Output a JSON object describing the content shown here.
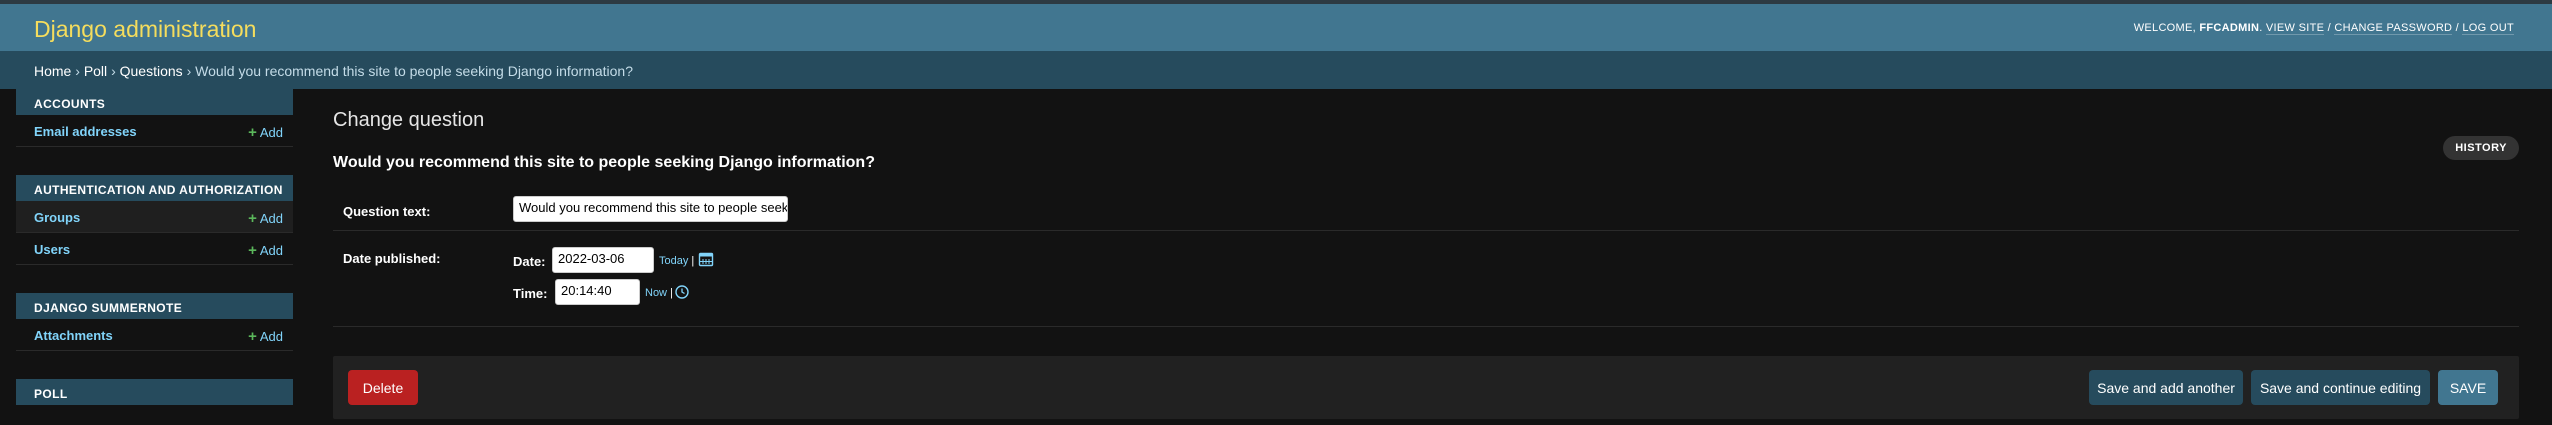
{
  "header": {
    "brand": "Django administration",
    "welcome": "WELCOME,",
    "username": "FFCADMIN",
    "view_site": "VIEW SITE",
    "change_password": "CHANGE PASSWORD",
    "log_out": "LOG OUT",
    "sep1": ".",
    "sep2": "/",
    "sep3": "/"
  },
  "breadcrumbs": {
    "home": "Home",
    "app": "Poll",
    "model": "Questions",
    "current": "Would you recommend this site to people seeking Django information?",
    "sep": "›"
  },
  "sidebar": {
    "modules": [
      {
        "caption": "ACCOUNTS",
        "models": [
          {
            "name": "Email addresses",
            "add": "Add"
          }
        ]
      },
      {
        "caption": "AUTHENTICATION AND AUTHORIZATION",
        "models": [
          {
            "name": "Groups",
            "add": "Add"
          },
          {
            "name": "Users",
            "add": "Add"
          }
        ]
      },
      {
        "caption": "DJANGO SUMMERNOTE",
        "models": [
          {
            "name": "Attachments",
            "add": "Add"
          }
        ]
      },
      {
        "caption": "POLL",
        "models": []
      }
    ]
  },
  "main": {
    "page_title": "Change question",
    "history": "HISTORY",
    "object_title": "Would you recommend this site to people seeking Django information?",
    "question_text_label": "Question text:",
    "question_text_value": "Would you recommend this site to people seeking Django information?",
    "date_published_label": "Date published:",
    "date_label": "Date:",
    "date_value": "2022-03-06",
    "today": "Today",
    "time_label": "Time:",
    "time_value": "20:14:40",
    "now": "Now",
    "pipe": "|"
  },
  "buttons": {
    "delete": "Delete",
    "save_add_another": "Save and add another",
    "save_continue": "Save and continue editing",
    "save": "SAVE"
  },
  "colors": {
    "header_bg": "#417690",
    "breadcrumb_bg": "#264b5d",
    "brand": "#f5dd5d",
    "link": "#81d4fa",
    "delete": "#ba2121",
    "body_bg": "#121212"
  }
}
